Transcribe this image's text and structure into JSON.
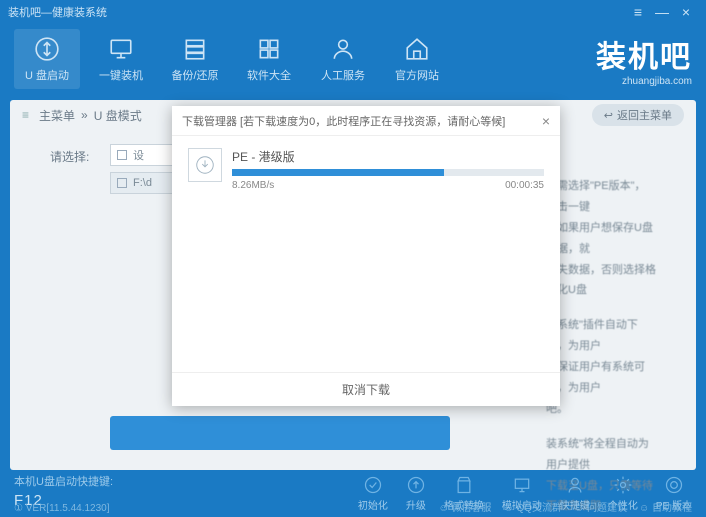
{
  "window": {
    "title": "装机吧—健康装系统"
  },
  "nav": {
    "items": [
      {
        "label": "U 盘启动"
      },
      {
        "label": "一键装机"
      },
      {
        "label": "备份/还原"
      },
      {
        "label": "软件大全"
      },
      {
        "label": "人工服务"
      },
      {
        "label": "官方网站"
      }
    ]
  },
  "brand": {
    "name": "装机吧",
    "url": "zhuangjiba.com"
  },
  "crumbs": {
    "a": "主菜单",
    "sep": "»",
    "b": "U 盘模式",
    "back": "返回主菜单"
  },
  "panel": {
    "select_label": "请选择:",
    "row1": "设",
    "row2": "F:\\d"
  },
  "modal": {
    "title": "下载管理器 [若下载速度为0，此时程序正在寻找资源，请耐心等候]",
    "item_name": "PE - 港级版",
    "speed": "8.26MB/s",
    "eta": "00:00:35",
    "cancel": "取消下载"
  },
  "bottom": {
    "hint": "本机U盘启动快捷键:",
    "key": "F12",
    "version": "VER[11.5.44.1230]",
    "icons": [
      {
        "label": "初始化"
      },
      {
        "label": "升级"
      },
      {
        "label": "格式转换"
      },
      {
        "label": "模拟启动"
      },
      {
        "label": "快捷键"
      },
      {
        "label": "个性化"
      },
      {
        "label": "PE 版本"
      }
    ],
    "links": [
      {
        "label": "微信客服"
      },
      {
        "label": "QQ交流群"
      },
      {
        "label": "问题建议"
      },
      {
        "label": "自助教程"
      }
    ]
  },
  "bgtext": {
    "l1": "不需选择\"PE版本\"，点击一键",
    "l2": "。如果用户想保存U盘数据，就",
    "l3": "丢失数据，否则选择格式化U盘",
    "l4": "装系统\"插件自动下载，为用户",
    "l5": "，保证用户有系统可装，为用户",
    "l6": "吧。",
    "l7": "装系统\"将全程自动为用户提供",
    "l8": "下载至U盘，只需等待下载完成即"
  }
}
